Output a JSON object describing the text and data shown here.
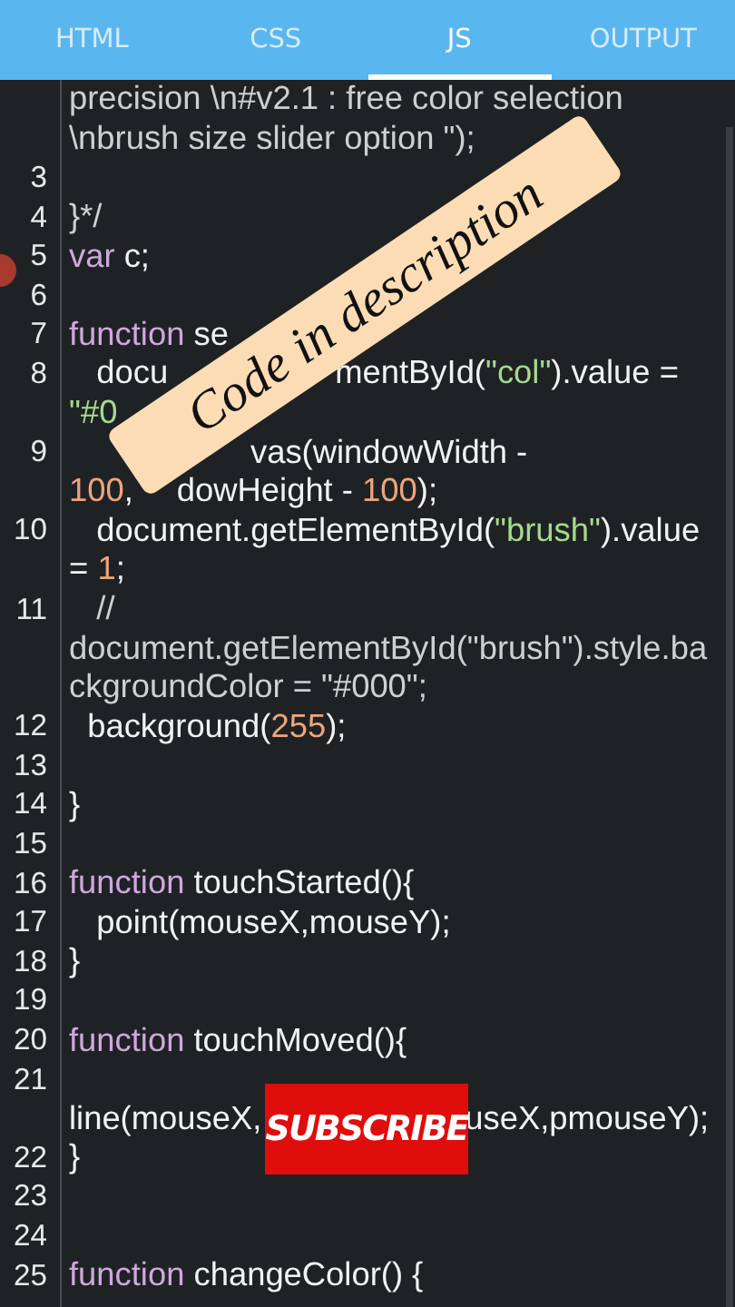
{
  "tabs": [
    {
      "label": "HTML",
      "selected": false
    },
    {
      "label": "CSS",
      "selected": false
    },
    {
      "label": "JS",
      "selected": true
    },
    {
      "label": "OUTPUT",
      "selected": false
    }
  ],
  "editor": {
    "rows": [
      {
        "number": null,
        "segments": [
          {
            "kind": "comment",
            "text": "precision \\n#v2.1 : free color selection"
          }
        ]
      },
      {
        "number": null,
        "segments": [
          {
            "kind": "comment",
            "text": "\\nbrush size slider option \");"
          }
        ]
      },
      {
        "number": "3",
        "segments": []
      },
      {
        "number": "4",
        "segments": [
          {
            "kind": "comment",
            "text": "}*/"
          }
        ]
      },
      {
        "number": "5",
        "segments": [
          {
            "kind": "keyword",
            "text": "var"
          },
          {
            "kind": "plain",
            "text": " c;"
          }
        ]
      },
      {
        "number": "6",
        "segments": []
      },
      {
        "number": "7",
        "segments": [
          {
            "kind": "keyword",
            "text": "function"
          },
          {
            "kind": "plain",
            "text": " se"
          }
        ]
      },
      {
        "number": "8",
        "segments": [
          {
            "kind": "plain",
            "text": "   docu"
          },
          {
            "kind": "covered"
          },
          {
            "kind": "plain",
            "text": "mentById("
          },
          {
            "kind": "string",
            "text": "\"col\""
          },
          {
            "kind": "plain",
            "text": ").value ="
          }
        ]
      },
      {
        "number": null,
        "segments": [
          {
            "kind": "string",
            "text": "\"#0"
          }
        ]
      },
      {
        "number": "9",
        "segments": [
          {
            "kind": "covered"
          },
          {
            "kind": "plain",
            "text": "vas(windowWidth -"
          }
        ]
      },
      {
        "number": null,
        "segments": [
          {
            "kind": "number",
            "text": "100"
          },
          {
            "kind": "plain",
            "text": ","
          },
          {
            "kind": "covered"
          },
          {
            "kind": "plain",
            "text": "dowHeight - "
          },
          {
            "kind": "number",
            "text": "100"
          },
          {
            "kind": "plain",
            "text": ");"
          }
        ]
      },
      {
        "number": "10",
        "segments": [
          {
            "kind": "plain",
            "text": "   document.getElementById("
          },
          {
            "kind": "string",
            "text": "\"brush\""
          },
          {
            "kind": "plain",
            "text": ").value"
          }
        ]
      },
      {
        "number": null,
        "segments": [
          {
            "kind": "plain",
            "text": "= "
          },
          {
            "kind": "number",
            "text": "1"
          },
          {
            "kind": "plain",
            "text": ";"
          }
        ]
      },
      {
        "number": "11",
        "segments": [
          {
            "kind": "comment",
            "text": "   //"
          }
        ]
      },
      {
        "number": null,
        "segments": [
          {
            "kind": "comment",
            "text": "document.getElementById(\"brush\").style.ba"
          }
        ]
      },
      {
        "number": null,
        "segments": [
          {
            "kind": "comment",
            "text": "ckgroundColor = \"#000\";"
          }
        ]
      },
      {
        "number": "12",
        "segments": [
          {
            "kind": "plain",
            "text": "  background("
          },
          {
            "kind": "number",
            "text": "255"
          },
          {
            "kind": "plain",
            "text": ");"
          }
        ]
      },
      {
        "number": "13",
        "segments": []
      },
      {
        "number": "14",
        "segments": [
          {
            "kind": "plain",
            "text": "}"
          }
        ]
      },
      {
        "number": "15",
        "segments": []
      },
      {
        "number": "16",
        "segments": [
          {
            "kind": "keyword",
            "text": "function"
          },
          {
            "kind": "plain",
            "text": " touchStarted(){"
          }
        ]
      },
      {
        "number": "17",
        "segments": [
          {
            "kind": "plain",
            "text": "   point(mouseX,mouseY);"
          }
        ]
      },
      {
        "number": "18",
        "segments": [
          {
            "kind": "plain",
            "text": "}"
          }
        ]
      },
      {
        "number": "19",
        "segments": []
      },
      {
        "number": "20",
        "segments": [
          {
            "kind": "keyword",
            "text": "function"
          },
          {
            "kind": "plain",
            "text": " touchMoved(){"
          }
        ]
      },
      {
        "number": "21",
        "segments": []
      },
      {
        "number": null,
        "segments": [
          {
            "kind": "plain",
            "text": "line(mouseX,"
          },
          {
            "kind": "covered"
          },
          {
            "kind": "plain",
            "text": "useX,pmouseY);"
          }
        ]
      },
      {
        "number": "22",
        "segments": [
          {
            "kind": "plain",
            "text": "}"
          }
        ]
      },
      {
        "number": "23",
        "segments": []
      },
      {
        "number": "24",
        "segments": []
      },
      {
        "number": "25",
        "segments": [
          {
            "kind": "keyword",
            "text": "function"
          },
          {
            "kind": "plain",
            "text": " changeColor() {"
          }
        ]
      }
    ]
  },
  "sticker": {
    "text": "Code in description"
  },
  "subscribe_badge": {
    "text": "SUBSCRIBE"
  }
}
